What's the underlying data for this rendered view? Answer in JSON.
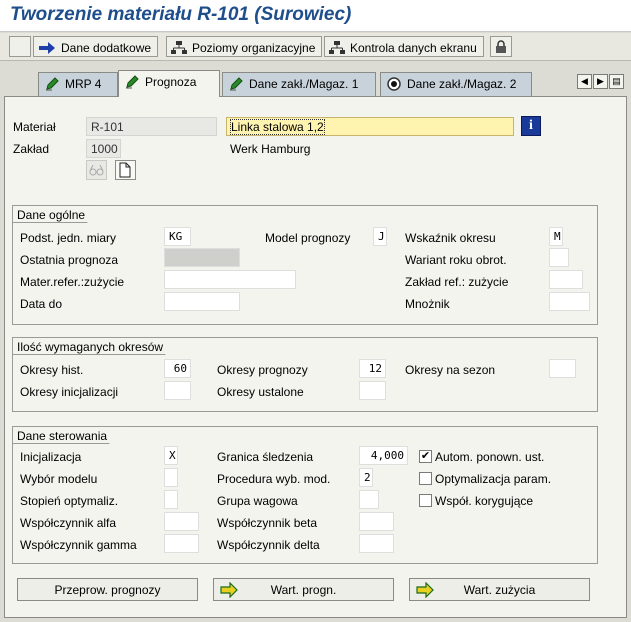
{
  "title": "Tworzenie materiału R-101 (Surowiec)",
  "toolbar": {
    "btn_dane_dodatkowe": "Dane dodatkowe",
    "btn_poziomy": "Poziomy organizacyjne",
    "btn_kontrola": "Kontrola danych ekranu"
  },
  "tabs": [
    {
      "label": "MRP 4"
    },
    {
      "label": "Prognoza"
    },
    {
      "label": "Dane zakł./Magaz. 1"
    },
    {
      "label": "Dane zakł./Magaz. 2"
    }
  ],
  "header": {
    "material_label": "Materiał",
    "material_value": "R-101",
    "material_desc": "Linka stalowa 1,2",
    "plant_label": "Zakład",
    "plant_value": "1000",
    "plant_desc": "Werk Hamburg"
  },
  "general": {
    "title": "Dane ogólne",
    "base_uom_label": "Podst. jedn. miary",
    "base_uom_value": "KG",
    "model_label": "Model prognozy",
    "model_value": "J",
    "period_ind_label": "Wskaźnik okresu",
    "period_ind_value": "M",
    "last_forecast_label": "Ostatnia prognoza",
    "fiscal_year_label": "Wariant roku obrot.",
    "ref_material_label": "Mater.refer.:zużycie",
    "ref_plant_label": "Zakład ref.: zużycie",
    "date_to_label": "Data do",
    "multiplier_label": "Mnożnik"
  },
  "periods": {
    "title": "Ilość wymaganych okresów",
    "hist_label": "Okresy hist.",
    "hist_value": "60",
    "forecast_label": "Okresy prognozy",
    "forecast_value": "12",
    "season_label": "Okresy na sezon",
    "init_label": "Okresy inicjalizacji",
    "fixed_label": "Okresy ustalone"
  },
  "control": {
    "title": "Dane sterowania",
    "init_label": "Inicjalizacja",
    "init_value": "X",
    "tracking_label": "Granica śledzenia",
    "tracking_value": "4,000",
    "auto_reset_label": "Autom. ponown. ust.",
    "auto_reset_checked": "✔",
    "model_sel_label": "Wybór modelu",
    "procedure_label": "Procedura wyb. mod.",
    "procedure_value": "2",
    "optimize_label": "Optymalizacja param.",
    "opt_level_label": "Stopień optymaliz.",
    "weight_group_label": "Grupa wagowa",
    "correction_label": "Współ. korygujące",
    "alpha_label": "Współczynnik alfa",
    "beta_label": "Współczynnik beta",
    "gamma_label": "Współczynnik gamma",
    "delta_label": "Współczynnik delta"
  },
  "buttons": {
    "run_forecast": "Przeprow. prognozy",
    "forecast_values": "Wart. progn.",
    "consumption_values": "Wart. zużycia"
  },
  "colors": {
    "title": "#1e4e8c",
    "highlight_field": "#fff3b0",
    "info_button": "#1a3a9a"
  }
}
